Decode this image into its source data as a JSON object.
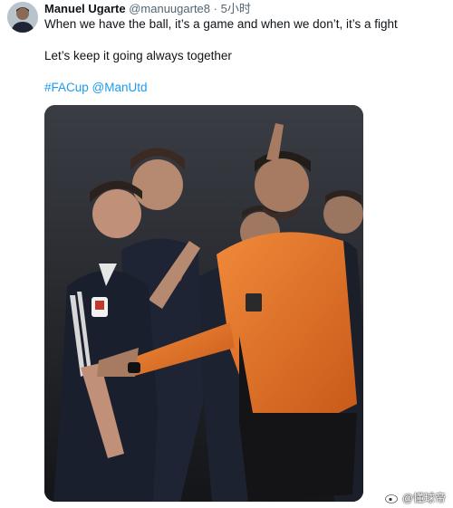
{
  "post": {
    "author_name": "Manuel Ugarte",
    "author_handle": "@manuugarte8",
    "separator": "·",
    "time": "5小时",
    "text_line1": "When we have the ball, it’s a game and when we don’t, it’s a fight",
    "text_line2": "Let’s keep it going always together",
    "hashtag": "#FACup",
    "mention": "@ManUtd"
  },
  "watermark": {
    "text": "@懂球帝"
  },
  "icons": {
    "avatar": "avatar",
    "watermark_logo": "weibo-icon"
  },
  "colors": {
    "link": "#1d9bf0",
    "text": "#0f1419",
    "muted": "#536471",
    "referee_shirt": "#e8752a",
    "player_kit": "#1e2433"
  }
}
